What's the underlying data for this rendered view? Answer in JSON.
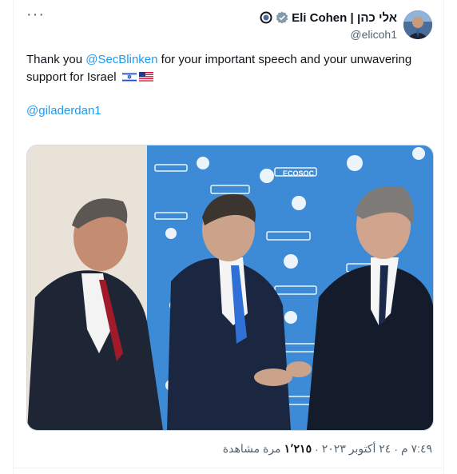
{
  "tweet": {
    "more_label": "···",
    "author": {
      "display_name": "Eli Cohen | אלי כהן",
      "handle": "@elicoh1"
    },
    "text_prefix": "Thank you ",
    "mention_1": "@SecBlinken",
    "text_suffix": " for your important speech and your unwavering support for Israel",
    "flags": [
      "flag-israel-icon",
      "flag-usa-icon"
    ],
    "mention_2": "@giladerdan1",
    "photo": {
      "banner_text": "ECOSOC"
    },
    "meta": {
      "time": "٧:٤٩ م",
      "separator": "·",
      "date": "٢٤ أكتوبر ٢٠٢٣",
      "views_count": "١٬٢١٥",
      "views_label": "مرة مشاهدة"
    }
  },
  "colors": {
    "link": "#1d9bf0",
    "text": "#0f1419",
    "muted": "#536471",
    "backdrop": "#3b8bd8"
  }
}
